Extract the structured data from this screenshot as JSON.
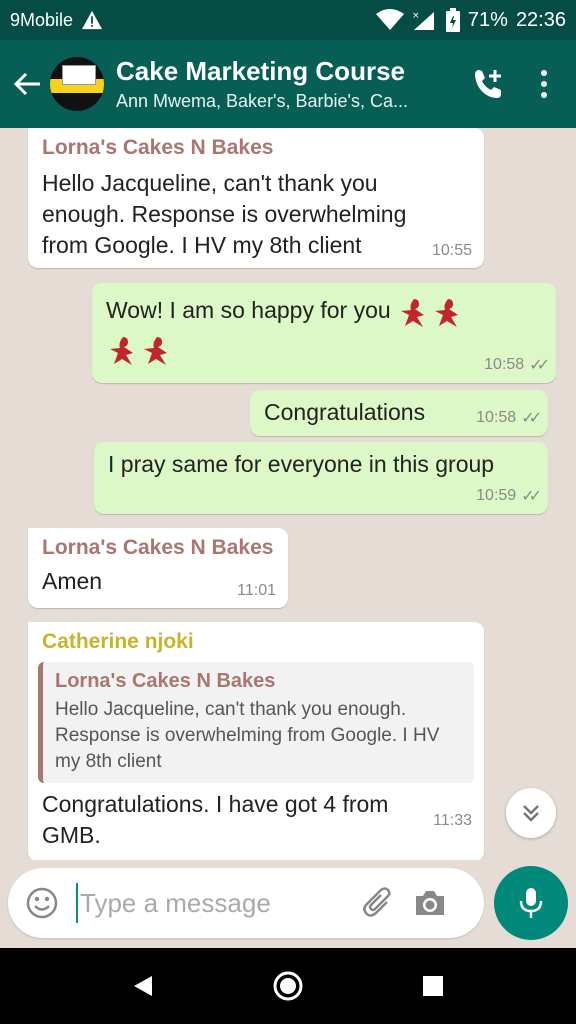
{
  "status_bar": {
    "carrier": "9Mobile",
    "battery": "71%",
    "time": "22:36"
  },
  "header": {
    "title": "Cake Marketing Course",
    "subtitle": "Ann Mwema, Baker's, Barbie's, Ca..."
  },
  "messages": [
    {
      "direction": "in",
      "sender": "Lorna's Cakes N Bakes",
      "text": "Hello Jacqueline, can't thank you enough. Response is overwhelming from Google. I HV my 8th client",
      "time": "10:55"
    },
    {
      "direction": "out",
      "text": "Wow! I am so happy for you",
      "time": "10:58",
      "emoji_count": 4
    },
    {
      "direction": "out",
      "text": "Congratulations",
      "time": "10:58"
    },
    {
      "direction": "out",
      "text": "I pray same for everyone in this group",
      "time": "10:59"
    },
    {
      "direction": "in",
      "sender": "Lorna's Cakes N Bakes",
      "text": "Amen",
      "time": "11:01"
    },
    {
      "direction": "in",
      "sender": "Catherine njoki",
      "quote": {
        "sender": "Lorna's Cakes N Bakes",
        "text": "Hello Jacqueline, can't thank you enough. Response is overwhelming from Google. I HV my 8th client"
      },
      "text": "Congratulations. I have got 4 from GMB.",
      "time": "11:33"
    }
  ],
  "input": {
    "placeholder": "Type a message"
  },
  "colors": {
    "header_bg": "#075e54",
    "status_bg": "#054d44",
    "outgoing_bubble": "#dcf8c6",
    "incoming_bubble": "#ffffff",
    "mic_button": "#00897b"
  },
  "icons": [
    "warning-icon",
    "wifi-icon",
    "signal-icon",
    "battery-icon",
    "back-arrow-icon",
    "add-call-icon",
    "more-options-icon",
    "emoji-icon",
    "attach-icon",
    "camera-icon",
    "mic-icon",
    "scroll-down-icon",
    "nav-back-icon",
    "nav-home-icon",
    "nav-recents-icon"
  ]
}
